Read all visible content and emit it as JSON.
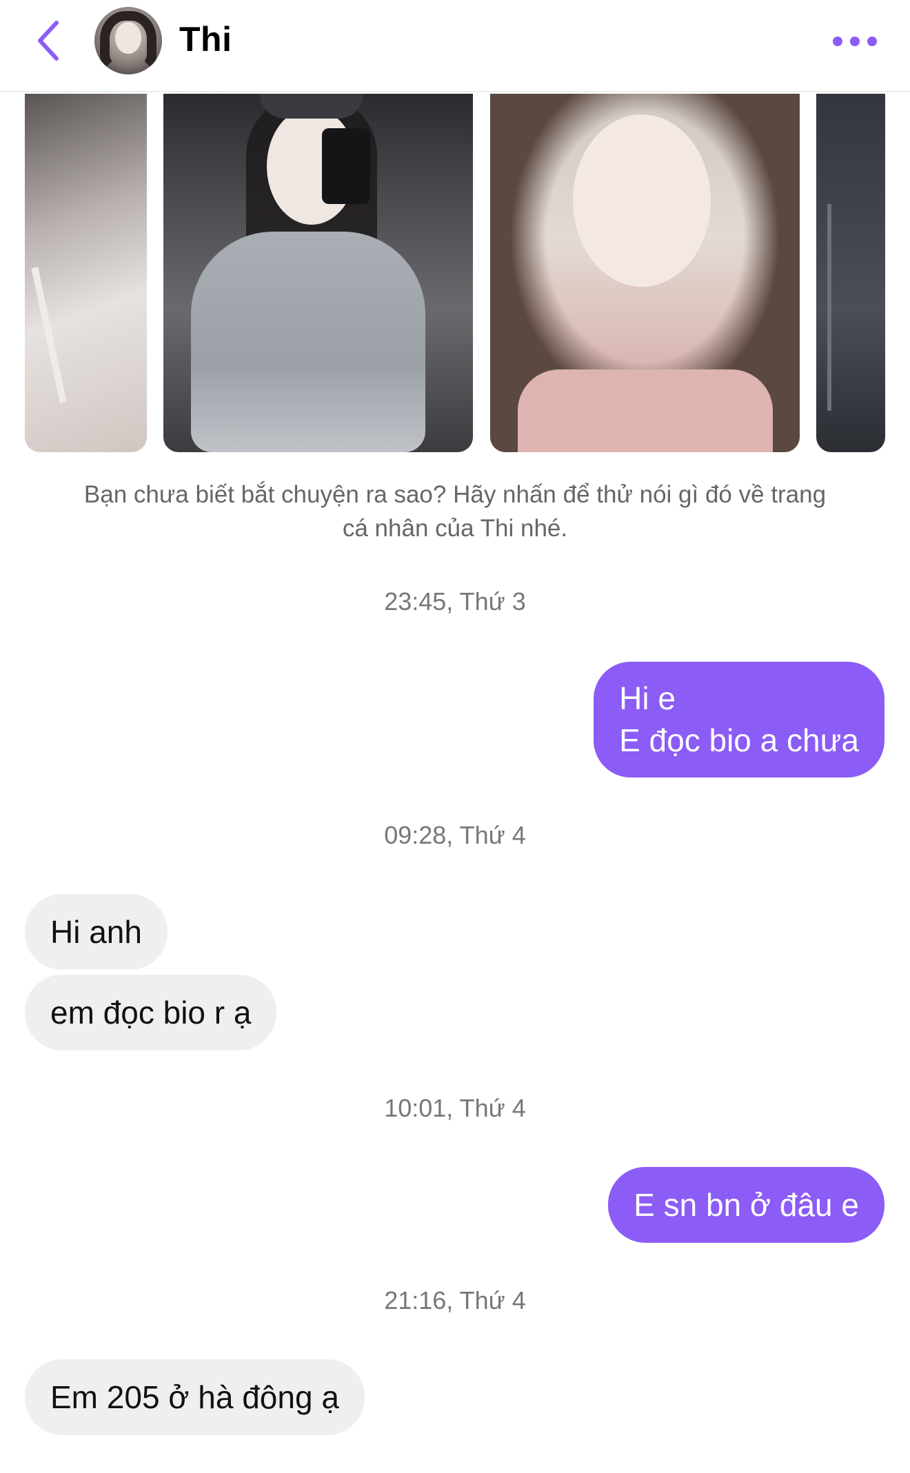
{
  "header": {
    "contact_name": "Thi",
    "back_icon": "chevron-left-icon",
    "more_icon": "more-horizontal-icon",
    "accent_color": "#8b5cf6"
  },
  "profile_photos": {
    "count_visible": 4
  },
  "hint": "Bạn chưa biết bắt chuyện ra sao? Hãy nhấn để thử nói gì đó về trang\ncá nhân của Thi nhé.",
  "conversation": {
    "timestamps": [
      "23:45, Thứ 3",
      "09:28, Thứ 4",
      "10:01, Thứ 4",
      "21:16, Thứ 4"
    ],
    "messages": [
      {
        "direction": "outgoing",
        "text": "Hi e\nE đọc bio a chưa"
      },
      {
        "direction": "incoming",
        "text": "Hi anh"
      },
      {
        "direction": "incoming",
        "text": "em đọc bio r ạ"
      },
      {
        "direction": "outgoing",
        "text": "E sn bn ở đâu e"
      },
      {
        "direction": "incoming",
        "text": "Em 205 ở hà đông ạ"
      }
    ],
    "outgoing_color": "#8b5cf6",
    "incoming_color": "#efefef"
  }
}
